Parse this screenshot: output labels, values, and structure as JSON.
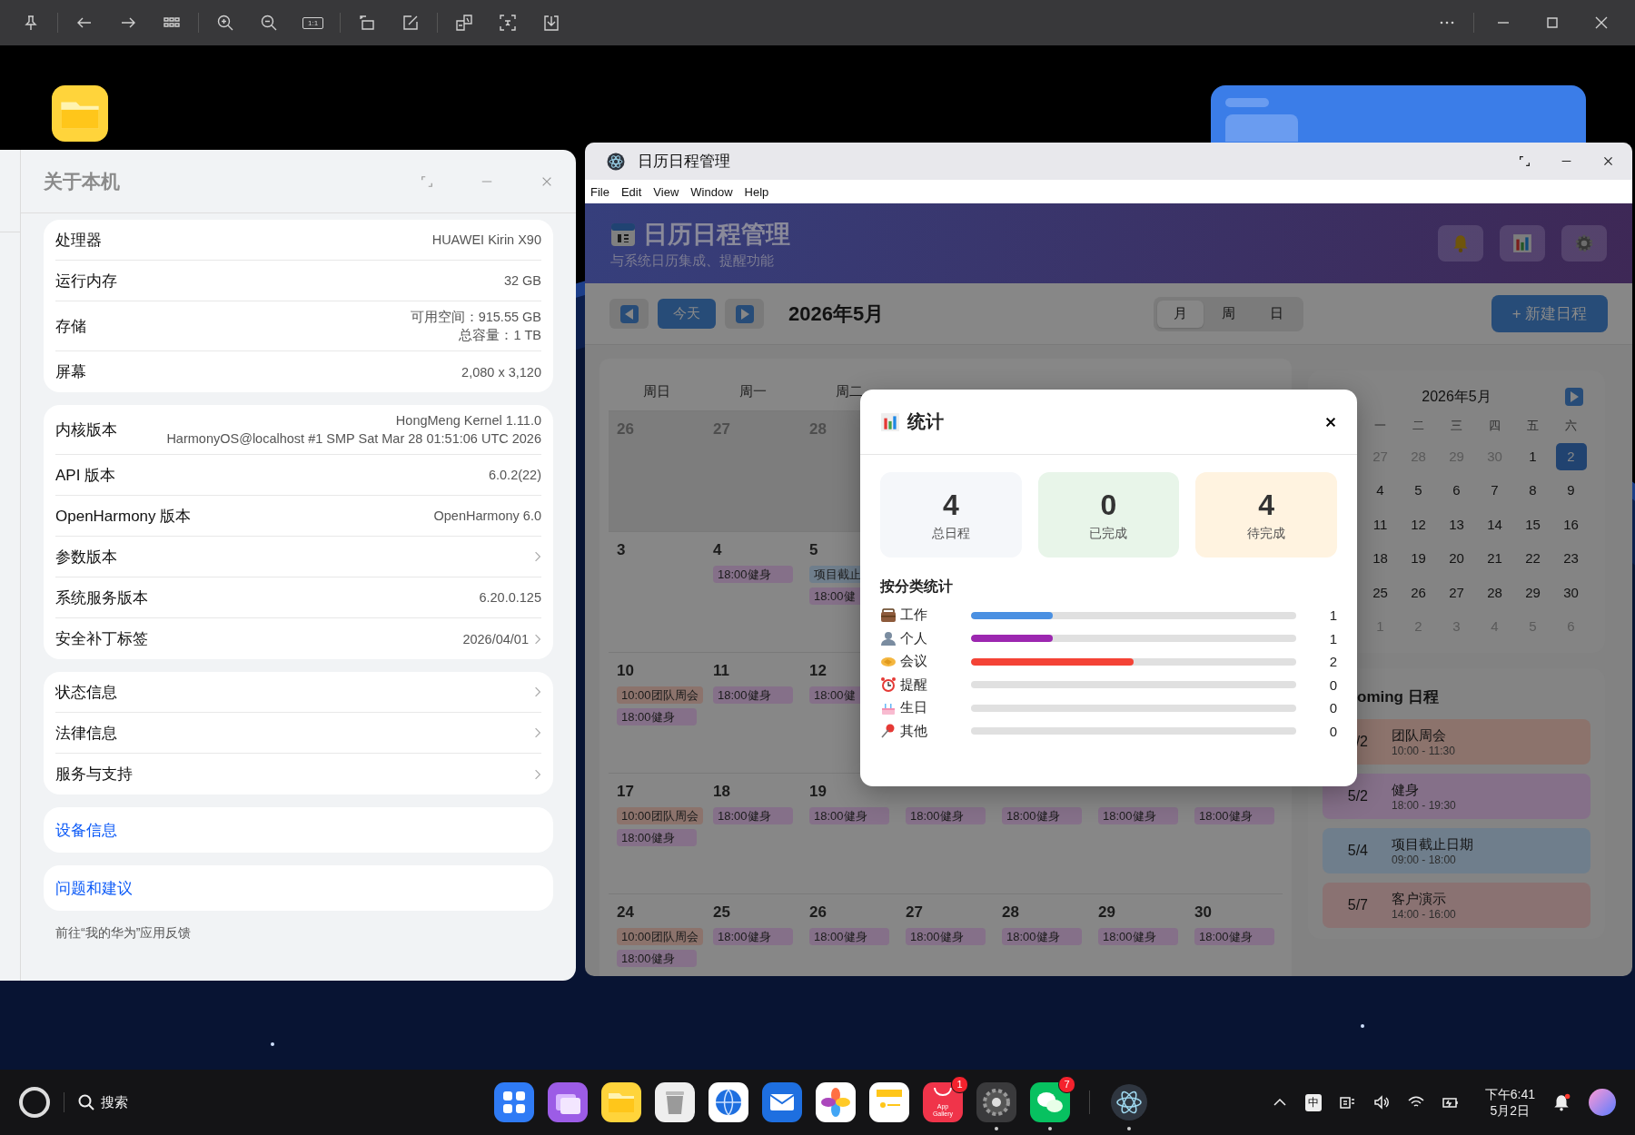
{
  "viewer_toolbar": {
    "actual_size_label": "1:1"
  },
  "about_window": {
    "title": "关于本机",
    "groups": [
      {
        "rows": [
          {
            "label": "处理器",
            "value": [
              "HUAWEI Kirin X90"
            ],
            "arrow": false
          },
          {
            "label": "运行内存",
            "value": [
              "32 GB"
            ],
            "arrow": false
          },
          {
            "label": "存储",
            "value": [
              "可用空间：915.55 GB",
              "总容量：1 TB"
            ],
            "arrow": false
          },
          {
            "label": "屏幕",
            "value": [
              "2,080 x 3,120"
            ],
            "arrow": false
          }
        ]
      },
      {
        "rows": [
          {
            "label": "内核版本",
            "value": [
              "HongMeng Kernel 1.11.0",
              "HarmonyOS@localhost #1 SMP Sat Mar 28 01:51:06 UTC 2026"
            ],
            "arrow": false
          },
          {
            "label": "API 版本",
            "value": [
              "6.0.2(22)"
            ],
            "arrow": false
          },
          {
            "label": "OpenHarmony 版本",
            "value": [
              "OpenHarmony 6.0"
            ],
            "arrow": false
          },
          {
            "label": "参数版本",
            "arrow": true
          },
          {
            "label": "系统服务版本",
            "value": [
              "6.20.0.125"
            ],
            "arrow": false
          },
          {
            "label": "安全补丁标签",
            "value": [
              "2026/04/01"
            ],
            "arrow": true
          }
        ]
      },
      {
        "rows": [
          {
            "label": "状态信息",
            "arrow": true
          },
          {
            "label": "法律信息",
            "arrow": true
          },
          {
            "label": "服务与支持",
            "arrow": true
          }
        ]
      }
    ],
    "links": [
      "设备信息",
      "问题和建议"
    ],
    "footer": "前往“我的华为”应用反馈"
  },
  "calendar_window": {
    "title": "日历日程管理",
    "menu": [
      "File",
      "Edit",
      "View",
      "Window",
      "Help"
    ],
    "header": {
      "title": "日历日程管理",
      "subtitle": "与系统日历集成、提醒功能"
    },
    "toolbar": {
      "today": "今天",
      "month_label": "2026年5月",
      "views": [
        {
          "label": "月",
          "selected": true
        },
        {
          "label": "周",
          "selected": false
        },
        {
          "label": "日",
          "selected": false
        }
      ],
      "new_button": "+ 新建日程"
    },
    "weekdays": [
      "周日",
      "周一",
      "周二"
    ],
    "weeks": [
      [
        {
          "date": "26",
          "outside": true
        },
        {
          "date": "27",
          "outside": true
        },
        {
          "date": "28",
          "outside": true
        }
      ],
      [
        {
          "date": "3",
          "outside": false
        },
        {
          "date": "4",
          "outside": false,
          "events": [
            {
              "text": "18:00健身",
              "color": "#857089"
            }
          ]
        },
        {
          "date": "5",
          "outside": false,
          "events": [
            {
              "text": "项目截止",
              "color": "#6f7e8c"
            },
            {
              "text": "18:00健",
              "color": "#857089"
            }
          ]
        }
      ],
      [
        {
          "date": "10",
          "outside": false,
          "events": [
            {
              "text": "10:00团队周会",
              "color": "#8c736c"
            },
            {
              "text": "18:00健身",
              "color": "#857089"
            }
          ]
        },
        {
          "date": "11",
          "outside": false,
          "events": [
            {
              "text": "18:00健身",
              "color": "#857089"
            }
          ]
        },
        {
          "date": "12",
          "outside": false,
          "events": [
            {
              "text": "18:00健",
              "color": "#857089"
            }
          ]
        }
      ],
      [
        {
          "date": "17",
          "outside": false,
          "events": [
            {
              "text": "10:00团队周会",
              "color": "#8c736c"
            },
            {
              "text": "18:00健身",
              "color": "#857089"
            }
          ]
        },
        {
          "date": "18",
          "outside": false,
          "events": [
            {
              "text": "18:00健身",
              "color": "#857089"
            }
          ]
        },
        {
          "date": "19",
          "outside": false,
          "events": [
            {
              "text": "18:00健身",
              "color": "#857089"
            }
          ]
        },
        {
          "events": [
            {
              "text": "18:00健身",
              "color": "#857089"
            }
          ]
        },
        {
          "events": [
            {
              "text": "18:00健身",
              "color": "#857089"
            }
          ]
        },
        {
          "events": [
            {
              "text": "18:00健身",
              "color": "#857089"
            }
          ]
        },
        {
          "events": [
            {
              "text": "18:00健身",
              "color": "#857089"
            }
          ]
        }
      ],
      [
        {
          "date": "24",
          "outside": false,
          "events": [
            {
              "text": "10:00团队周会",
              "color": "#8c736c"
            },
            {
              "text": "18:00健身",
              "color": "#857089"
            }
          ]
        },
        {
          "date": "25",
          "outside": false,
          "events": [
            {
              "text": "18:00健身",
              "color": "#857089"
            }
          ]
        },
        {
          "date": "26",
          "outside": false,
          "events": [
            {
              "text": "18:00健身",
              "color": "#857089"
            }
          ]
        },
        {
          "date": "27",
          "outside": false,
          "events": [
            {
              "text": "18:00健身",
              "color": "#857089"
            }
          ]
        },
        {
          "date": "28",
          "outside": false,
          "events": [
            {
              "text": "18:00健身",
              "color": "#857089"
            }
          ]
        },
        {
          "date": "29",
          "outside": false,
          "events": [
            {
              "text": "18:00健身",
              "color": "#857089"
            }
          ]
        },
        {
          "date": "30",
          "outside": false,
          "events": [
            {
              "text": "18:00健身",
              "color": "#857089"
            }
          ]
        }
      ]
    ],
    "mini_calendar": {
      "title": "2026年5月",
      "weekdays": [
        "一",
        "二",
        "三",
        "四",
        "五",
        "六"
      ],
      "weeks": [
        [
          {
            "d": "27",
            "outside": true,
            "selected": false
          },
          {
            "d": "28",
            "outside": true,
            "selected": false
          },
          {
            "d": "29",
            "outside": true,
            "selected": false
          },
          {
            "d": "30",
            "outside": true,
            "selected": false
          },
          {
            "d": "1",
            "outside": false,
            "selected": false
          },
          {
            "d": "2",
            "outside": false,
            "selected": true
          }
        ],
        [
          {
            "d": "4",
            "outside": false,
            "selected": false
          },
          {
            "d": "5",
            "outside": false,
            "selected": false
          },
          {
            "d": "6",
            "outside": false,
            "selected": false
          },
          {
            "d": "7",
            "outside": false,
            "selected": false
          },
          {
            "d": "8",
            "outside": false,
            "selected": false
          },
          {
            "d": "9",
            "outside": false,
            "selected": false
          }
        ],
        [
          {
            "d": "11",
            "outside": false,
            "selected": false
          },
          {
            "d": "12",
            "outside": false,
            "selected": false
          },
          {
            "d": "13",
            "outside": false,
            "selected": false
          },
          {
            "d": "14",
            "outside": false,
            "selected": false
          },
          {
            "d": "15",
            "outside": false,
            "selected": false
          },
          {
            "d": "16",
            "outside": false,
            "selected": false
          }
        ],
        [
          {
            "d": "18",
            "outside": false,
            "selected": false
          },
          {
            "d": "19",
            "outside": false,
            "selected": false
          },
          {
            "d": "20",
            "outside": false,
            "selected": false
          },
          {
            "d": "21",
            "outside": false,
            "selected": false
          },
          {
            "d": "22",
            "outside": false,
            "selected": false
          },
          {
            "d": "23",
            "outside": false,
            "selected": false
          }
        ],
        [
          {
            "d": "25",
            "outside": false,
            "selected": false
          },
          {
            "d": "26",
            "outside": false,
            "selected": false
          },
          {
            "d": "27",
            "outside": false,
            "selected": false
          },
          {
            "d": "28",
            "outside": false,
            "selected": false
          },
          {
            "d": "29",
            "outside": false,
            "selected": false
          },
          {
            "d": "30",
            "outside": false,
            "selected": false
          }
        ],
        [
          {
            "d": "1",
            "outside": true,
            "selected": false
          },
          {
            "d": "2",
            "outside": true,
            "selected": false
          },
          {
            "d": "3",
            "outside": true,
            "selected": false
          },
          {
            "d": "4",
            "outside": true,
            "selected": false
          },
          {
            "d": "5",
            "outside": true,
            "selected": false
          },
          {
            "d": "6",
            "outside": true,
            "selected": false
          }
        ]
      ]
    },
    "upcoming": {
      "title": "oming 日程",
      "items": [
        {
          "date": "/2",
          "name": "团队周会",
          "time": "10:00 - 11:30",
          "color": "#8c736c"
        },
        {
          "date": "5/2",
          "name": "健身",
          "time": "18:00 - 19:30",
          "color": "#857089"
        },
        {
          "date": "5/4",
          "name": "项目截止日期",
          "time": "09:00 - 18:00",
          "color": "#6f7e8c"
        },
        {
          "date": "5/7",
          "name": "客户演示",
          "time": "14:00 - 16:00",
          "color": "#8a7272"
        }
      ]
    },
    "stats_dialog": {
      "title": "统计",
      "cards": [
        {
          "kind": "total",
          "value": "4",
          "label": "总日程"
        },
        {
          "kind": "done",
          "value": "0",
          "label": "已完成"
        },
        {
          "kind": "pending",
          "value": "4",
          "label": "待完成"
        }
      ],
      "section_title": "按分类统计",
      "categories": [
        {
          "kind": "work",
          "label": "工作",
          "level": 0.25,
          "count": "1",
          "color": "#4a90e2"
        },
        {
          "kind": "personal",
          "label": "个人",
          "level": 0.25,
          "count": "1",
          "color": "#9c27b0"
        },
        {
          "kind": "meeting",
          "label": "会议",
          "level": 0.5,
          "count": "2",
          "color": "#f44336"
        },
        {
          "kind": "reminder",
          "label": "提醒",
          "count": "0"
        },
        {
          "kind": "birthday",
          "label": "生日",
          "count": "0"
        },
        {
          "kind": "other",
          "label": "其他",
          "count": "0"
        }
      ]
    }
  },
  "taskbar": {
    "search": "搜索",
    "dock": [
      {
        "kind": "launcher",
        "running": false
      },
      {
        "kind": "cards",
        "running": false
      },
      {
        "kind": "files",
        "running": false
      },
      {
        "kind": "trash",
        "running": false
      },
      {
        "kind": "browser",
        "running": false
      },
      {
        "kind": "mail",
        "running": false
      },
      {
        "kind": "photos",
        "running": false
      },
      {
        "kind": "notes",
        "running": false
      },
      {
        "kind": "gallery",
        "label": "App Gallery",
        "badge": "1",
        "running": false
      },
      {
        "kind": "settings",
        "running": true
      },
      {
        "kind": "chat",
        "badge": "7",
        "running": true
      }
    ],
    "pinned": [
      {
        "kind": "atom",
        "running": true
      }
    ],
    "tray": {
      "ime": "中",
      "time": "下午6:41",
      "date": "5月2日"
    }
  }
}
